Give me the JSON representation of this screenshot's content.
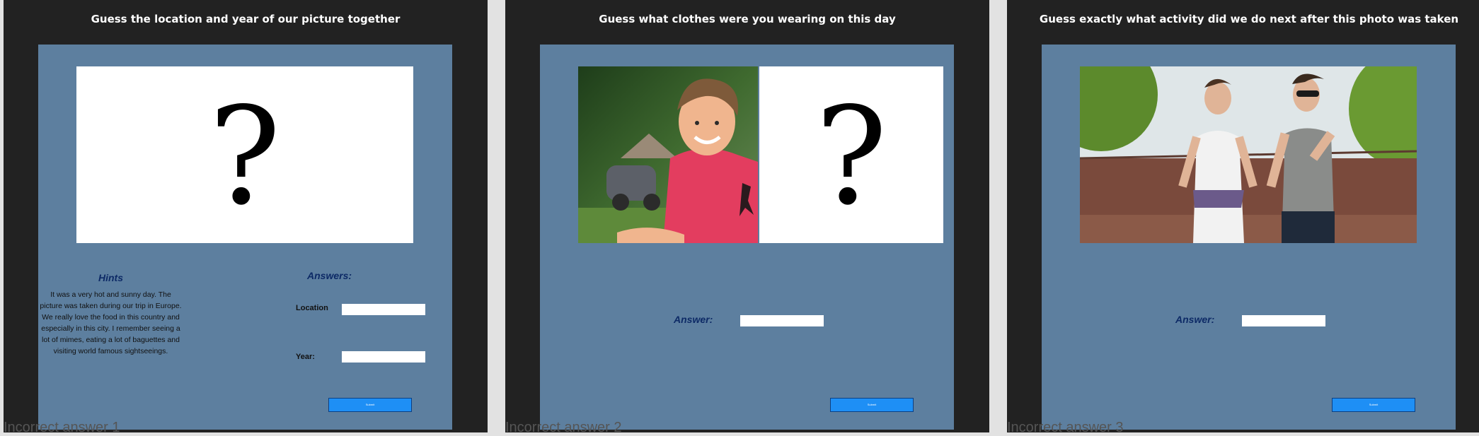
{
  "panels": [
    {
      "title": "Guess the location and year of our picture together",
      "photo_placeholder": "?",
      "hints": {
        "title": "Hints",
        "text": "It was a very hot and sunny day.  The picture was taken during our trip in Europe.  We really love the food in this country and especially in this city.  I remember seeing a lot of  mimes, eating a lot of baguettes and visiting world famous sightseeings."
      },
      "answers_title": "Answers:",
      "location_label": "Location",
      "year_label": "Year:",
      "submit_label": "Submit",
      "footnote": "Incorrect answer 1"
    },
    {
      "title": "Guess what clothes were you wearing on this day",
      "photo_placeholder": "?",
      "answer_label": "Answer:",
      "submit_label": "Submit",
      "footnote": "Incorrect answer 2"
    },
    {
      "title": "Guess exactly what activity did we do next after this photo was taken",
      "answer_label": "Answer:",
      "submit_label": "Submit",
      "footnote": "Incorrect answer 3"
    }
  ],
  "colors": {
    "background": "#e2e2e2",
    "panel": "#222222",
    "card": "#5d7f9f",
    "heading": "#0d2a66",
    "submit": "#1e8ff5"
  }
}
